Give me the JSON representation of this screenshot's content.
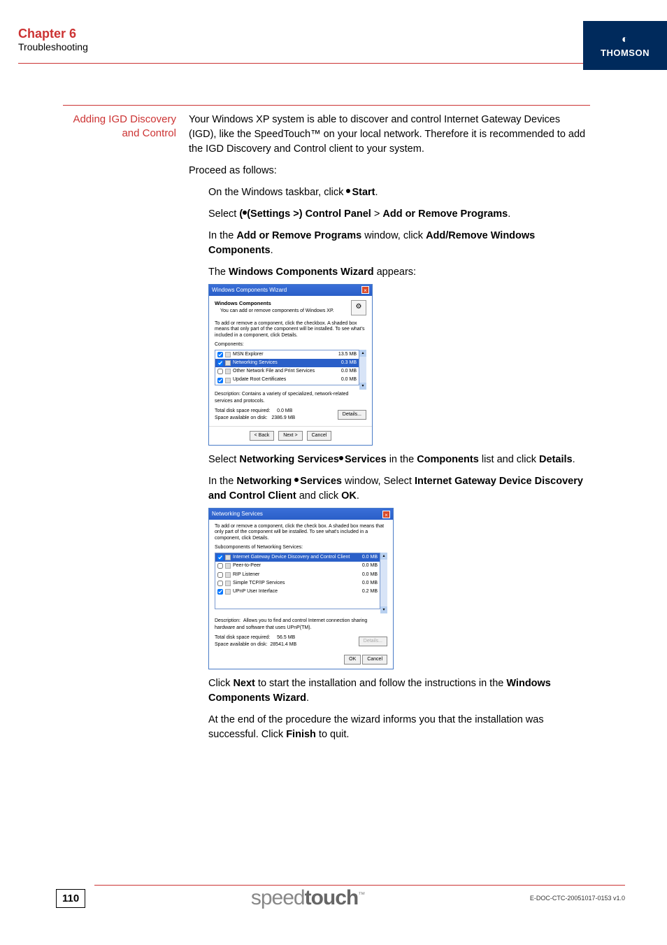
{
  "header": {
    "chapter": "Chapter 6",
    "subtitle": "Troubleshooting",
    "brand": "THOMSON"
  },
  "section": {
    "label_line1": "Adding IGD Discovery",
    "label_line2": "and Control",
    "intro": "Your Windows XP system is able to discover and control Internet Gateway Devices (IGD), like the SpeedTouch™ on your local network. Therefore it is recommended to add the IGD Discovery and Control client to your system.",
    "proceed": "Proceed as follows:",
    "step1_a": "On the Windows taskbar, click ",
    "step1_b": "Start",
    "step1_c": ".",
    "step2_a": "Select ",
    "step2_b": "(Settings >) Control Panel",
    "step2_c": " > ",
    "step2_d": "Add or Remove Programs",
    "step2_e": ".",
    "step3_a": "In the ",
    "step3_b": "Add or Remove Programs",
    "step3_c": " window, click ",
    "step3_d": "Add/Remove Windows Components",
    "step3_e": ".",
    "step4_a": "The ",
    "step4_b": "Windows Components Wizard",
    "step4_c": " appears:",
    "step5_a": "Select ",
    "step5_b": "Networking Services",
    "step5_c": " in the ",
    "step5_d": "Components",
    "step5_e": " list and click ",
    "step5_f": "Details",
    "step5_g": ".",
    "step6_a": "In the ",
    "step6_b": "Networking Services",
    "step6_c": " window, Select ",
    "step6_d": "Internet Gateway Device Discovery and Control Client",
    "step6_e": " and click ",
    "step6_f": "OK",
    "step6_g": ".",
    "step7_a": "Click ",
    "step7_b": "Next",
    "step7_c": " to start the installation and follow the instructions in the ",
    "step7_d": "Windows Components Wizard",
    "step7_e": ".",
    "step8_a": "At the end of the procedure the wizard informs you that the installation was successful. Click ",
    "step8_b": "Finish",
    "step8_c": " to quit."
  },
  "dlg1": {
    "title": "Windows Components Wizard",
    "h1": "Windows Components",
    "h2": "You can add or remove components of Windows XP.",
    "instr": "To add or remove a component, click the checkbox. A shaded box means that only part of the component will be installed. To see what's included in a component, click Details.",
    "components_label": "Components:",
    "rows": [
      {
        "checked": true,
        "name": "MSN Explorer",
        "size": "13.5 MB",
        "sel": false
      },
      {
        "checked": true,
        "name": "Networking Services",
        "size": "0.3 MB",
        "sel": true
      },
      {
        "checked": false,
        "name": "Other Network File and Print Services",
        "size": "0.0 MB",
        "sel": false
      },
      {
        "checked": true,
        "name": "Update Root Certificates",
        "size": "0.0 MB",
        "sel": false
      }
    ],
    "desc_label": "Description:",
    "desc": "Contains a variety of specialized, network-related services and protocols.",
    "req_label": "Total disk space required:",
    "req_val": "0.0 MB",
    "avail_label": "Space available on disk:",
    "avail_val": "2386.9 MB",
    "details_btn": "Details...",
    "back": "< Back",
    "next": "Next >",
    "cancel": "Cancel"
  },
  "dlg2": {
    "title": "Networking Services",
    "instr": "To add or remove a component, click the check box. A shaded box means that only part of the component will be installed. To see what's included in a component, click Details.",
    "sub_label": "Subcomponents of Networking Services:",
    "rows": [
      {
        "checked": true,
        "name": "Internet Gateway Device Discovery and Control Client",
        "size": "0.0 MB",
        "sel": true
      },
      {
        "checked": false,
        "name": "Peer-to-Peer",
        "size": "0.0 MB",
        "sel": false
      },
      {
        "checked": false,
        "name": "RIP Listener",
        "size": "0.0 MB",
        "sel": false
      },
      {
        "checked": false,
        "name": "Simple TCP/IP Services",
        "size": "0.0 MB",
        "sel": false
      },
      {
        "checked": true,
        "name": "UPnP User Interface",
        "size": "0.2 MB",
        "sel": false
      }
    ],
    "desc_label": "Description:",
    "desc": "Allows you to find and control Internet connection sharing hardware and software that uses UPnP(TM).",
    "req_label": "Total disk space required:",
    "req_val": "56.5 MB",
    "avail_label": "Space available on disk:",
    "avail_val": "28541.4 MB",
    "details_btn": "Details...",
    "ok": "OK",
    "cancel": "Cancel"
  },
  "footer": {
    "page": "110",
    "brand_a": "speed",
    "brand_b": "touch",
    "docref": "E-DOC-CTC-20051017-0153 v1.0"
  }
}
